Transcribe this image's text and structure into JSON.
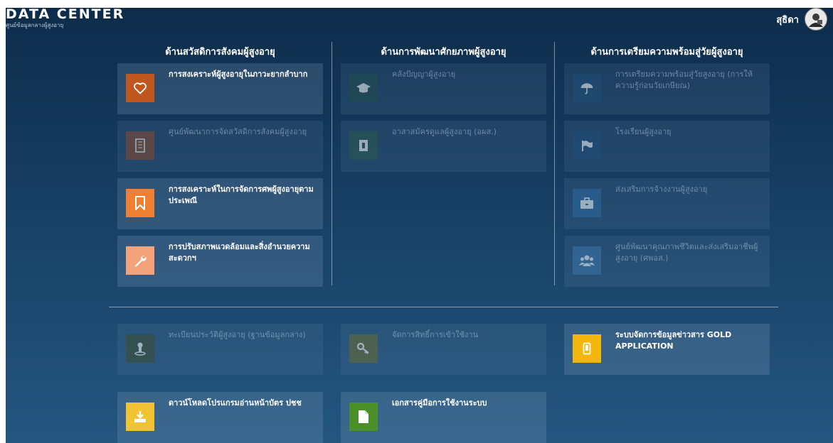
{
  "header": {
    "brand_title": "DATA CENTER",
    "brand_subtitle": "ศูนย์ข้อมูลกลางผู้สูงอายุ",
    "user_name": "สุธิดา"
  },
  "columns": [
    {
      "title": "ด้านสวัสดิการสังคมผู้สูงอายุ",
      "cards": [
        {
          "label": "การสงเคราะห์ผู้สูงอายุในภาวะยากลำบาก",
          "icon": "heart-icon",
          "color": "#c0571f",
          "enabled": true
        },
        {
          "label": "ศูนย์พัฒนาการจัดสวัสดิการสังคมผู้สูงอายุ",
          "icon": "building-icon",
          "color": "#8a4a2a",
          "enabled": false
        },
        {
          "label": "การสงเคราะห์ในการจัดการศพผู้สูงอายุตามประเพณี",
          "icon": "bookmark-icon",
          "color": "#ef7f33",
          "enabled": true
        },
        {
          "label": "การปรับสภาพแวดล้อมและสิ่งอำนวยความสะดวกฯ",
          "icon": "wrench-icon",
          "color": "#f3a27a",
          "enabled": true
        }
      ]
    },
    {
      "title": "ด้านการพัฒนาศักยภาพผู้สูงอายุ",
      "cards": [
        {
          "label": "คลังปัญญาผู้สูงอายุ",
          "icon": "graduation-cap-icon",
          "color": "#1f4f4a",
          "enabled": false
        },
        {
          "label": "อาสาสมัครดูแลผู้สูงอายุ (อผส.)",
          "icon": "id-badge-icon",
          "color": "#2a5a4c",
          "enabled": false
        }
      ]
    },
    {
      "title": "ด้านการเตรียมความพร้อมสู่วัยผู้สูงอายุ",
      "cards": [
        {
          "label": "การเตรียมความพร้อมสู่วัยสูงอายุ (การให้ความรู้ก่อนวัยเกษียณ)",
          "icon": "umbrella-icon",
          "color": "#1f4e7a",
          "enabled": false
        },
        {
          "label": "โรงเรียนผู้สูงอายุ",
          "icon": "flag-icon",
          "color": "#1f4e7a",
          "enabled": false
        },
        {
          "label": "ส่งเสริมการจ้างงานผู้สูงอายุ",
          "icon": "briefcase-icon",
          "color": "#2d6aa0",
          "enabled": false
        },
        {
          "label": "ศูนย์พัฒนาคุณภาพชีวิตและส่งเสริมอาชีพผู้สูงอายุ (ศพอส.)",
          "icon": "users-icon",
          "color": "#3b75a8",
          "enabled": false
        }
      ]
    }
  ],
  "bottom_cards": [
    {
      "label": "ทะเบียนประวัติผู้สูงอายุ (ฐานข้อมูลกลาง)",
      "icon": "person-pin-icon",
      "color": "#3c4b2c",
      "enabled": false
    },
    {
      "label": "จัดการสิทธิ์การเข้าใช้งาน",
      "icon": "key-icon",
      "color": "#6b6a2c",
      "enabled": false
    },
    {
      "label": "ระบบจัดการข้อมูลข่าวสาร GOLD APPLICATION",
      "icon": "mobile-icon",
      "color": "#f2b60c",
      "enabled": true
    },
    {
      "label": "ดาวน์โหลดโปรแกรมอ่านหน้าบัตร ปชช",
      "icon": "download-icon",
      "color": "#f1c232",
      "enabled": true
    },
    {
      "label": "เอกสารคู่มือการใช้งานระบบ",
      "icon": "document-icon",
      "color": "#4a8f2a",
      "enabled": true
    }
  ]
}
